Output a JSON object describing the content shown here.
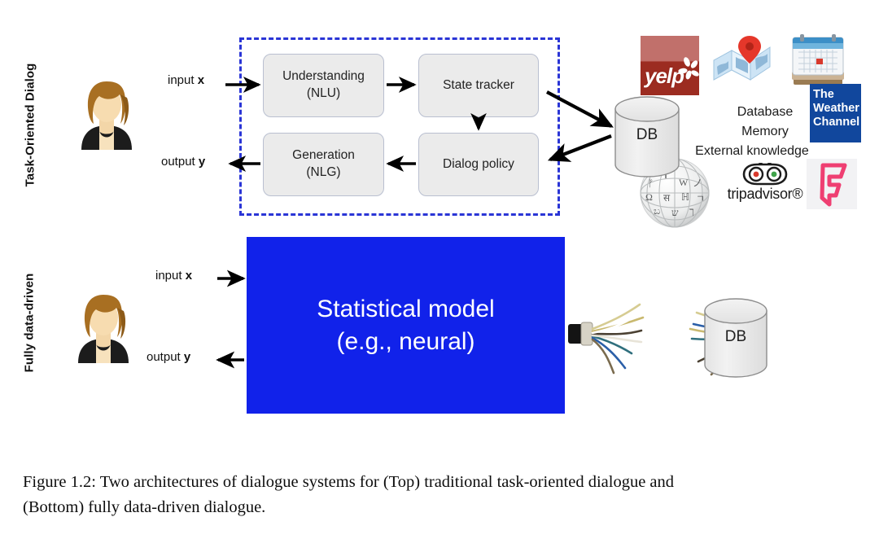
{
  "figure": {
    "caption_line_1": "Figure 1.2:  Two architectures of dialogue systems for (Top) traditional task-oriented dialogue and",
    "caption_line_2": "(Bottom) fully data-driven dialogue."
  },
  "rows": {
    "top": {
      "row_label": "Task-Oriented Dialog",
      "input_label_text": "input ",
      "input_label_var": "x",
      "output_label_text": "output ",
      "output_label_var": "y",
      "avatar_name": "user-avatar",
      "pipeline": {
        "boxes": [
          {
            "id": "nlu",
            "line1": "Understanding",
            "line2": "(NLU)"
          },
          {
            "id": "state-tracker",
            "line1": "State tracker",
            "line2": ""
          },
          {
            "id": "nlg",
            "line1": "Generation",
            "line2": "(NLG)"
          },
          {
            "id": "dialog-policy",
            "line1": "Dialog policy",
            "line2": ""
          }
        ],
        "container_style": "dashed",
        "container_color": "#2a35d6"
      },
      "database": {
        "label": "DB"
      },
      "knowledge_sources": {
        "lines": [
          "Database",
          "Memory",
          "External knowledge"
        ],
        "logos": [
          {
            "id": "yelp",
            "label": "yelp"
          },
          {
            "id": "maps",
            "label": "maps"
          },
          {
            "id": "calendar",
            "label": "calendar"
          },
          {
            "id": "the-weather-channel",
            "label_line1": "The",
            "label_line2": "Weather",
            "label_line3": "Channel"
          },
          {
            "id": "wikipedia",
            "label": "wikipedia"
          },
          {
            "id": "tripadvisor",
            "label": "tripadvisor®"
          },
          {
            "id": "foursquare",
            "label": "foursquare"
          }
        ]
      }
    },
    "bottom": {
      "row_label": "Fully data-driven",
      "input_label_text": "input ",
      "input_label_var": "x",
      "output_label_text": "output ",
      "output_label_var": "y",
      "avatar_name": "user-avatar",
      "model_box": {
        "line1": "Statistical model",
        "line2": "(e.g., neural)",
        "bg_color": "#1122ea",
        "text_color": "#ffffff"
      },
      "database": {
        "label": "DB"
      },
      "connector": "frayed-network-cable"
    }
  }
}
